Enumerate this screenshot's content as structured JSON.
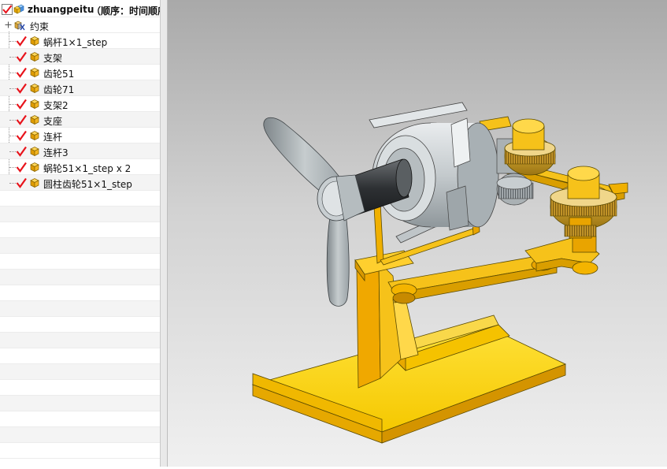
{
  "tree": {
    "root": {
      "name": "zhuangpeitu",
      "order": "（顺序：时间顺序"
    },
    "constraints_label": "约束",
    "parts": [
      "蜗杆1×1_step",
      "支架",
      "齿轮51",
      "齿轮71",
      "支架2",
      "支座",
      "连杆",
      "连杆3",
      "蜗轮51×1_step x 2",
      "圆柱齿轮51×1_step"
    ]
  },
  "colors": {
    "check": "#e8141c",
    "part_cube": "#f0b020",
    "model_yellow": "#f6c21a",
    "model_orange": "#e9a400",
    "model_gray": "#bfc5c8",
    "viewport_top": "#a9a9a9",
    "viewport_bottom": "#f0f0f0"
  },
  "icons": {
    "check": "red-checkmark-icon",
    "part": "part-cube-icon",
    "assembly": "assembly-icon",
    "constraint": "constraint-icon",
    "expand": "expand-plus-icon"
  }
}
